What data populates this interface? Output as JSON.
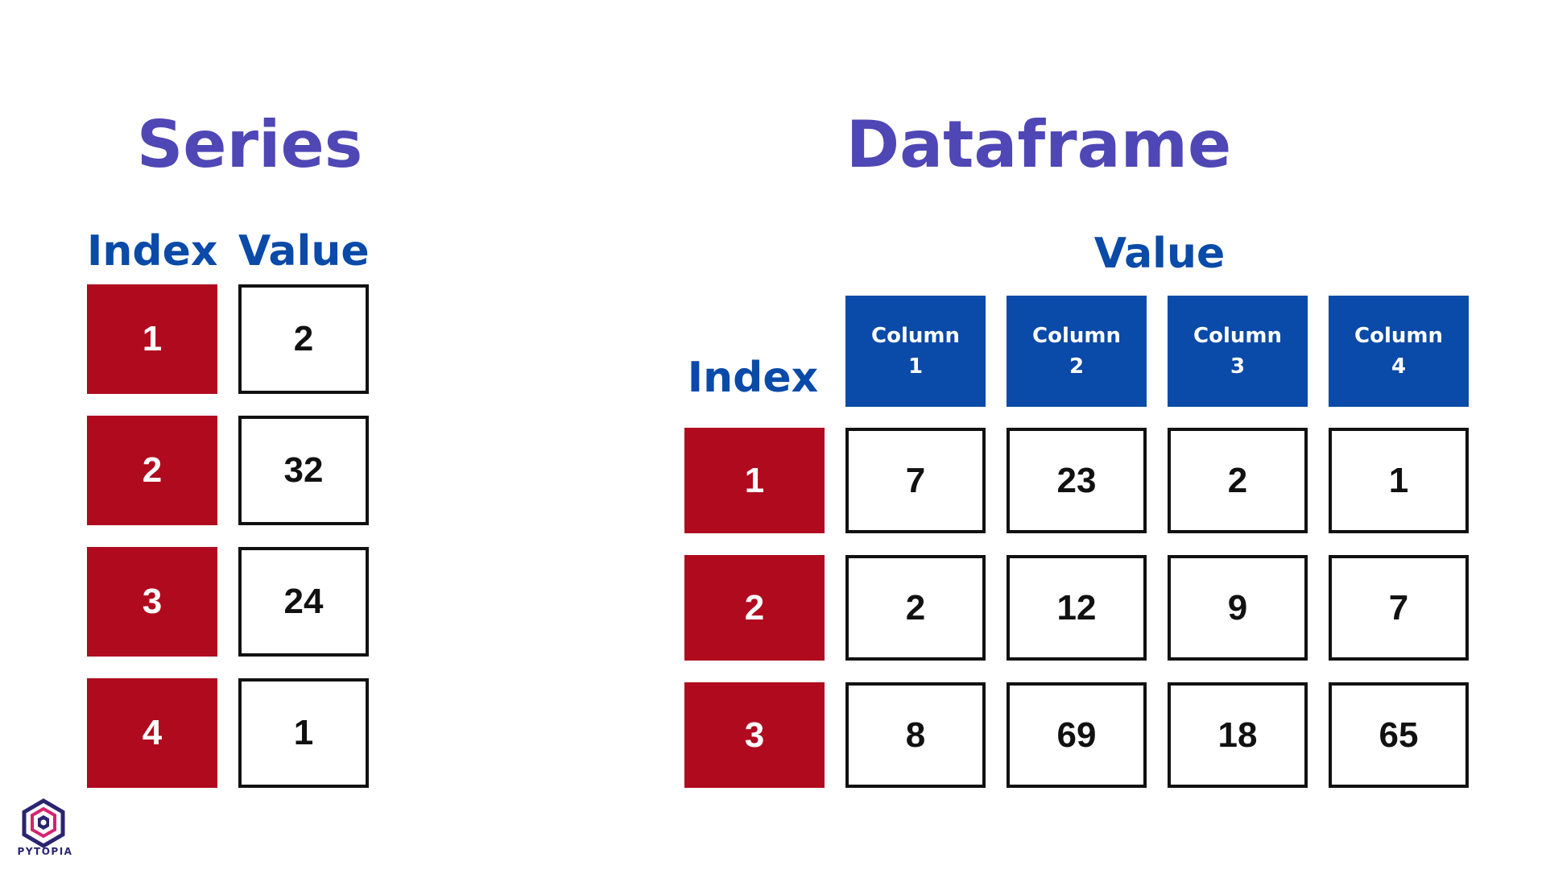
{
  "series": {
    "title": "Series",
    "index_header": "Index",
    "value_header": "Value",
    "rows": [
      {
        "index": "1",
        "value": "2"
      },
      {
        "index": "2",
        "value": "32"
      },
      {
        "index": "3",
        "value": "24"
      },
      {
        "index": "4",
        "value": "1"
      }
    ]
  },
  "dataframe": {
    "title": "Dataframe",
    "value_header": "Value",
    "index_header": "Index",
    "columns": [
      {
        "line1": "Column",
        "line2": "1"
      },
      {
        "line1": "Column",
        "line2": "2"
      },
      {
        "line1": "Column",
        "line2": "3"
      },
      {
        "line1": "Column",
        "line2": "4"
      }
    ],
    "rows": [
      {
        "index": "1",
        "values": [
          "7",
          "23",
          "2",
          "1"
        ]
      },
      {
        "index": "2",
        "values": [
          "2",
          "12",
          "9",
          "7"
        ]
      },
      {
        "index": "3",
        "values": [
          "8",
          "69",
          "18",
          "65"
        ]
      }
    ]
  },
  "logo": {
    "name": "PYTOPIA",
    "icon": "pytopia-hexagon-logo"
  },
  "colors": {
    "title": "#4f47b5",
    "header": "#0a4aa8",
    "index_fill": "#b00a1f",
    "cell_border": "#111111"
  }
}
